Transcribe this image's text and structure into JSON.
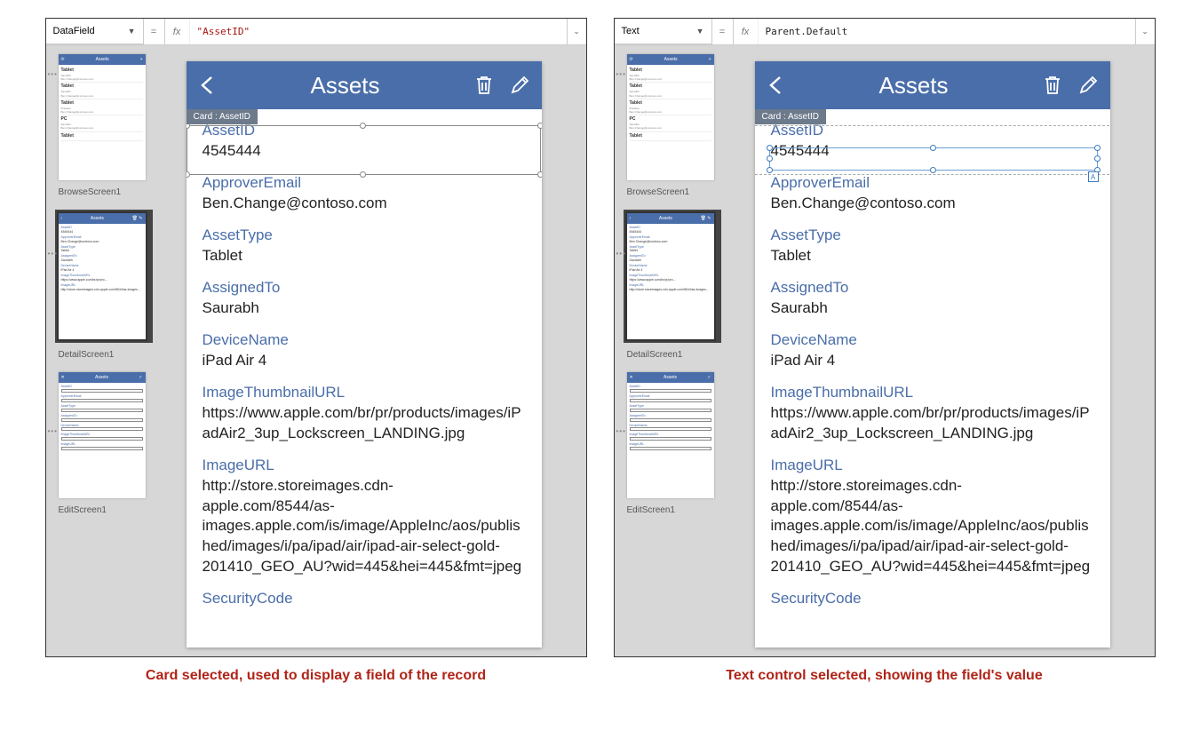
{
  "left": {
    "property": "DataField",
    "formula": "\"AssetID\"",
    "caption": "Card selected, used to display a field of the record"
  },
  "right": {
    "property": "Text",
    "formula": "Parent.Default",
    "caption": "Text control selected, showing the field's value"
  },
  "screens": {
    "browse": {
      "label": "BrowseScreen1",
      "title": "Assets",
      "items": [
        "Tablet",
        "Tablet",
        "Tablet",
        "PC",
        "Tablet"
      ]
    },
    "detail": {
      "label": "DetailScreen1",
      "title": "Assets"
    },
    "edit": {
      "label": "EditScreen1",
      "title": "Assets"
    }
  },
  "phone": {
    "title": "Assets",
    "card_tag": "Card : AssetID",
    "fields": {
      "assetid": {
        "label": "AssetID",
        "value": "4545444"
      },
      "approveremail": {
        "label": "ApproverEmail",
        "value": "Ben.Change@contoso.com"
      },
      "assettype": {
        "label": "AssetType",
        "value": "Tablet"
      },
      "assignedto": {
        "label": "AssignedTo",
        "value": "Saurabh"
      },
      "devicename": {
        "label": "DeviceName",
        "value": "iPad Air 4"
      },
      "imagethumb": {
        "label": "ImageThumbnailURL",
        "value": "https://www.apple.com/br/pr/products/images/iPadAir2_3up_Lockscreen_LANDING.jpg"
      },
      "imageurl": {
        "label": "ImageURL",
        "value": "http://store.storeimages.cdn-apple.com/8544/as-images.apple.com/is/image/AppleInc/aos/published/images/i/pa/ipad/air/ipad-air-select-gold-201410_GEO_AU?wid=445&hei=445&fmt=jpeg"
      },
      "securitycode": {
        "label": "SecurityCode",
        "value": ""
      }
    }
  }
}
